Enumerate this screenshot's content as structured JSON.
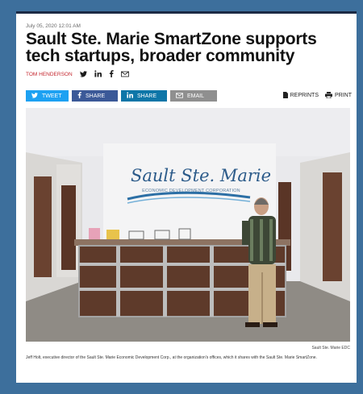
{
  "article": {
    "date": "July 05, 2020 12:01 AM",
    "headline": "Sault Ste. Marie SmartZone supports tech startups, broader community",
    "author": "TOM HENDERSON"
  },
  "byline_icons": [
    "twitter-icon",
    "linkedin-icon",
    "facebook-icon",
    "email-icon"
  ],
  "share": {
    "tweet": "TWEET",
    "fb_share": "SHARE",
    "li_share": "SHARE",
    "email": "EMAIL"
  },
  "utilities": {
    "reprints": "REPRINTS",
    "print": "PRINT"
  },
  "photo": {
    "sign_line1": "Sault Ste. Marie",
    "sign_line2": "ECONOMIC DEVELOPMENT CORPORATION",
    "credit": "Sault Ste. Marie EDC",
    "caption": "Jeff Holt, executive director of the Sault Ste. Marie Economic Development Corp., at the organization's offices, which it shares with the Sault Ste. Marie SmartZone."
  },
  "colors": {
    "background": "#3d6f9c",
    "author": "#c4262e",
    "twitter": "#1da1f2",
    "facebook": "#3b5998",
    "linkedin": "#0e76a8",
    "email_btn": "#8f8f8f"
  }
}
